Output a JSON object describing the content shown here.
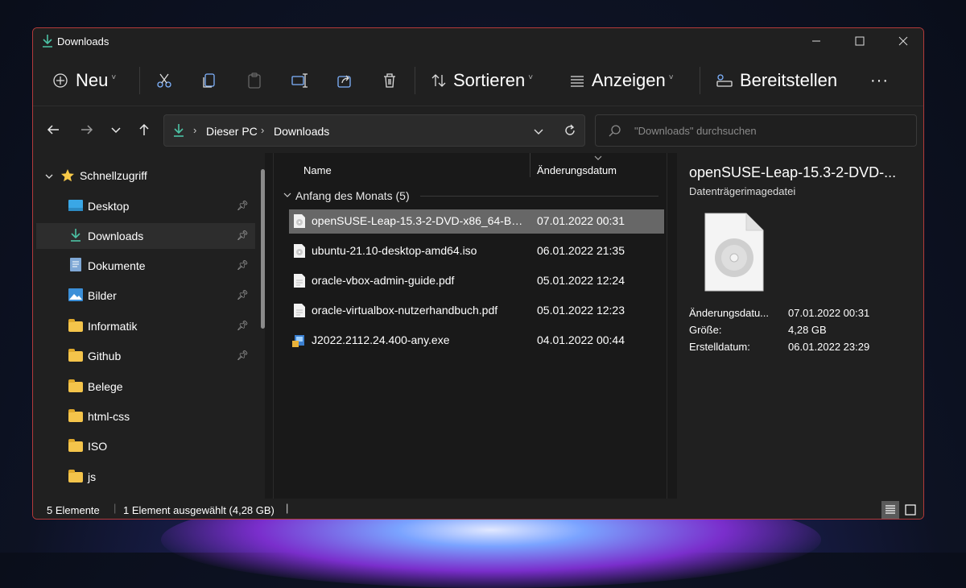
{
  "window": {
    "title": "Downloads"
  },
  "toolbar": {
    "new_label": "Neu",
    "sort_label": "Sortieren",
    "view_label": "Anzeigen",
    "share_label": "Bereitstellen",
    "more_label": "···"
  },
  "nav": {
    "breadcrumb": [
      "Dieser PC",
      "Downloads"
    ],
    "search_placeholder": "\"Downloads\" durchsuchen"
  },
  "sidebar": {
    "quick_access": "Schnellzugriff",
    "items": [
      {
        "label": "Desktop",
        "icon": "desktop-icon",
        "pinned": true
      },
      {
        "label": "Downloads",
        "icon": "download-icon",
        "pinned": true,
        "selected": true
      },
      {
        "label": "Dokumente",
        "icon": "document-icon",
        "pinned": true
      },
      {
        "label": "Bilder",
        "icon": "pictures-icon",
        "pinned": true
      },
      {
        "label": "Informatik",
        "icon": "folder-icon",
        "pinned": true
      },
      {
        "label": "Github",
        "icon": "folder-icon",
        "pinned": true
      },
      {
        "label": "Belege",
        "icon": "folder-icon",
        "pinned": false
      },
      {
        "label": "html-css",
        "icon": "folder-icon",
        "pinned": false
      },
      {
        "label": "ISO",
        "icon": "folder-icon",
        "pinned": false
      },
      {
        "label": "js",
        "icon": "folder-icon",
        "pinned": false
      }
    ]
  },
  "files": {
    "columns": {
      "name": "Name",
      "date": "Änderungsdatum"
    },
    "group": "Anfang des Monats (5)",
    "rows": [
      {
        "name": "openSUSE-Leap-15.3-2-DVD-x86_64-Build...",
        "date": "07.01.2022 00:31",
        "icon": "disc-image-icon",
        "selected": true
      },
      {
        "name": "ubuntu-21.10-desktop-amd64.iso",
        "date": "06.01.2022 21:35",
        "icon": "disc-image-icon"
      },
      {
        "name": "oracle-vbox-admin-guide.pdf",
        "date": "05.01.2022 12:24",
        "icon": "pdf-file-icon"
      },
      {
        "name": "oracle-virtualbox-nutzerhandbuch.pdf",
        "date": "05.01.2022 12:23",
        "icon": "pdf-file-icon"
      },
      {
        "name": "J2022.2112.24.400-any.exe",
        "date": "04.01.2022 00:44",
        "icon": "installer-icon"
      }
    ]
  },
  "details": {
    "title": "openSUSE-Leap-15.3-2-DVD-...",
    "type": "Datenträgerimagedatei",
    "props": [
      {
        "key": "Änderungsdatu...",
        "value": "07.01.2022 00:31"
      },
      {
        "key": "Größe:",
        "value": "4,28 GB"
      },
      {
        "key": "Erstelldatum:",
        "value": "06.01.2022 23:29"
      }
    ]
  },
  "status": {
    "count": "5 Elemente",
    "selection": "1 Element ausgewählt (4,28 GB)"
  },
  "colors": {
    "accent": "#4cc2a4",
    "window_border": "#b33a3a",
    "selected_row": "#676767"
  }
}
